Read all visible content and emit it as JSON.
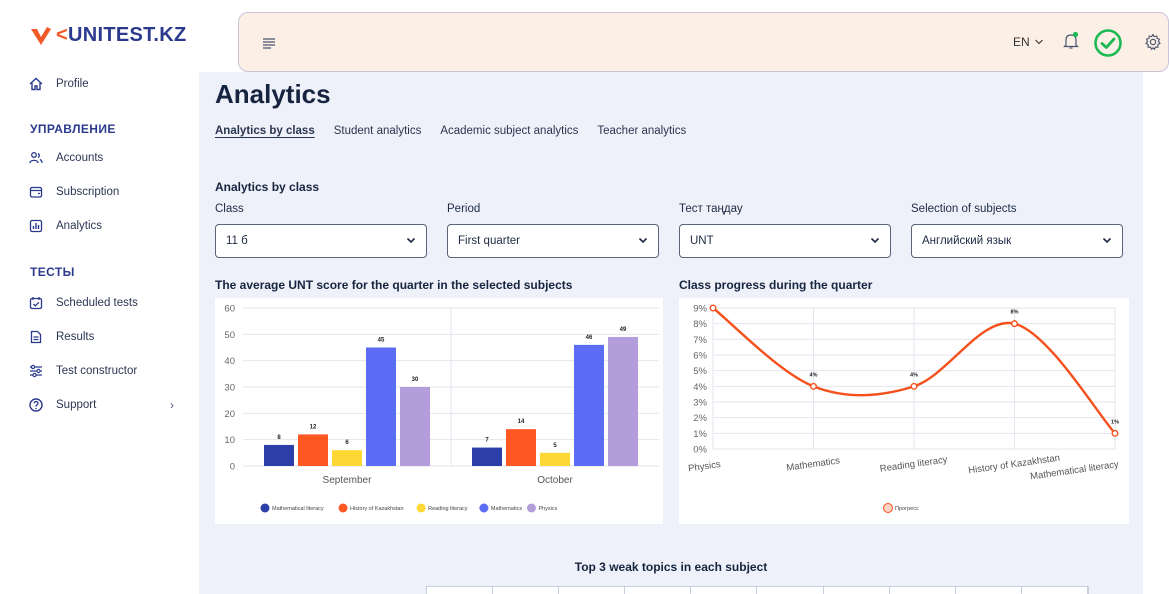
{
  "brand": {
    "logo_prefix": "<",
    "logo_text": "UNITEST.KZ"
  },
  "sidebar": {
    "profile": "Profile",
    "section_manage": "УПРАВЛЕНИЕ",
    "accounts": "Accounts",
    "subscription": "Subscription",
    "analytics": "Analytics",
    "section_tests": "ТЕСТЫ",
    "scheduled_tests": "Scheduled tests",
    "results": "Results",
    "test_constructor": "Test constructor",
    "support": "Support"
  },
  "topbar": {
    "language": "EN"
  },
  "page": {
    "title": "Analytics",
    "tabs": [
      "Analytics by class",
      "Student analytics",
      "Academic subject analytics",
      "Teacher analytics"
    ],
    "section_title": "Analytics by class",
    "filters": [
      {
        "label": "Class",
        "value": "11 б"
      },
      {
        "label": "Period",
        "value": "First quarter"
      },
      {
        "label": "Тест таңдау",
        "value": "UNT"
      },
      {
        "label": "Selection of subjects",
        "value": "Английский язык"
      }
    ],
    "bar_chart_title": "The average UNT score for the quarter in the selected subjects",
    "line_chart_title": "Class progress during the quarter",
    "bottom_title": "Top 3 weak topics in each subject"
  },
  "colors": {
    "brand_orange": "#f05a28",
    "brand_blue": "#2b3a8c",
    "check_green": "#1db954",
    "panel_bg": "#eef1f9",
    "topbar_bg": "#fcefe6"
  },
  "chart_data": [
    {
      "type": "bar",
      "categories": [
        "September",
        "October"
      ],
      "series": [
        {
          "name": "Mathematical literacy",
          "values": [
            8,
            7
          ],
          "color": "#2c3ea8"
        },
        {
          "name": "History of Kazakhstan",
          "values": [
            12,
            14
          ],
          "color": "#ff5722"
        },
        {
          "name": "Reading literacy",
          "values": [
            6,
            5
          ],
          "color": "#fdd835"
        },
        {
          "name": "Mathematics",
          "values": [
            45,
            46
          ],
          "color": "#5c6cf5"
        },
        {
          "name": "Physics",
          "values": [
            30,
            49
          ],
          "color": "#b39ddb"
        }
      ],
      "yticks": [
        "0",
        "10",
        "20",
        "30",
        "40",
        "50",
        "60"
      ],
      "ylim": [
        0,
        60
      ],
      "grid": true,
      "legend": "bottom"
    },
    {
      "type": "line",
      "categories": [
        "Physics",
        "Mathematics",
        "Reading literacy",
        "History of Kazakhstan",
        "Mathematical literacy"
      ],
      "series": [
        {
          "name": "Прогресс",
          "values": [
            9,
            4,
            4,
            8,
            1
          ],
          "color": "#f4511e"
        }
      ],
      "point_labels": [
        "",
        "4%",
        "4%",
        "8%",
        "1%"
      ],
      "yticks": [
        "0%",
        "1%",
        "2%",
        "3%",
        "4%",
        "5%",
        "6%",
        "7%",
        "8%",
        "9%"
      ],
      "ylim": [
        0,
        9
      ],
      "grid": true,
      "legend": "bottom"
    }
  ]
}
